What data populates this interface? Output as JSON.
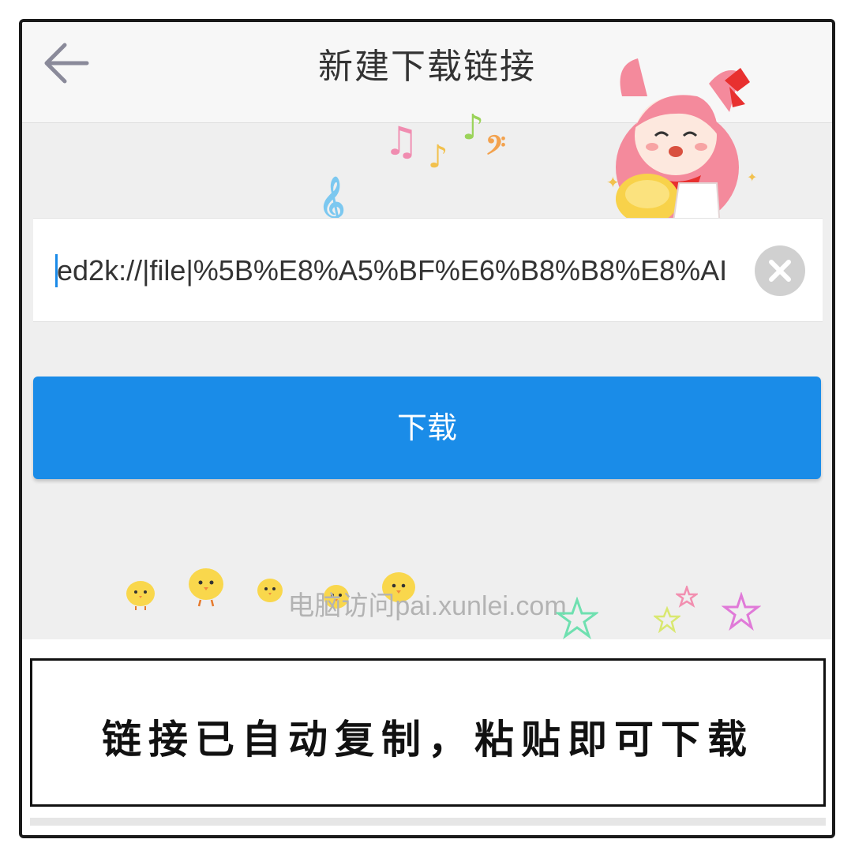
{
  "header": {
    "title": "新建下载链接",
    "back_icon": "arrow-left-icon"
  },
  "url_field": {
    "value": "ed2k://|file|%5B%E8%A5%BF%E6%B8%B8%E8%AI",
    "clear_icon": "clear-circle-icon"
  },
  "download_button": {
    "label": "下载"
  },
  "pc_access": {
    "text": "电脑访问pai.xunlei.com"
  },
  "caption": {
    "text": "链接已自动复制，粘贴即可下载"
  },
  "colors": {
    "accent": "#1a8ce8",
    "background": "#efefef",
    "topbar": "#f7f7f7"
  },
  "decorations": {
    "stickers": [
      "anime-girl-sticker",
      "music-notes-icon",
      "chick-icon",
      "star-icon"
    ],
    "music_glyphs": {
      "beamed_notes": "♫",
      "eighth_note": "♪",
      "bass_clef": "𝄢",
      "treble_clef": "𝄞"
    }
  }
}
